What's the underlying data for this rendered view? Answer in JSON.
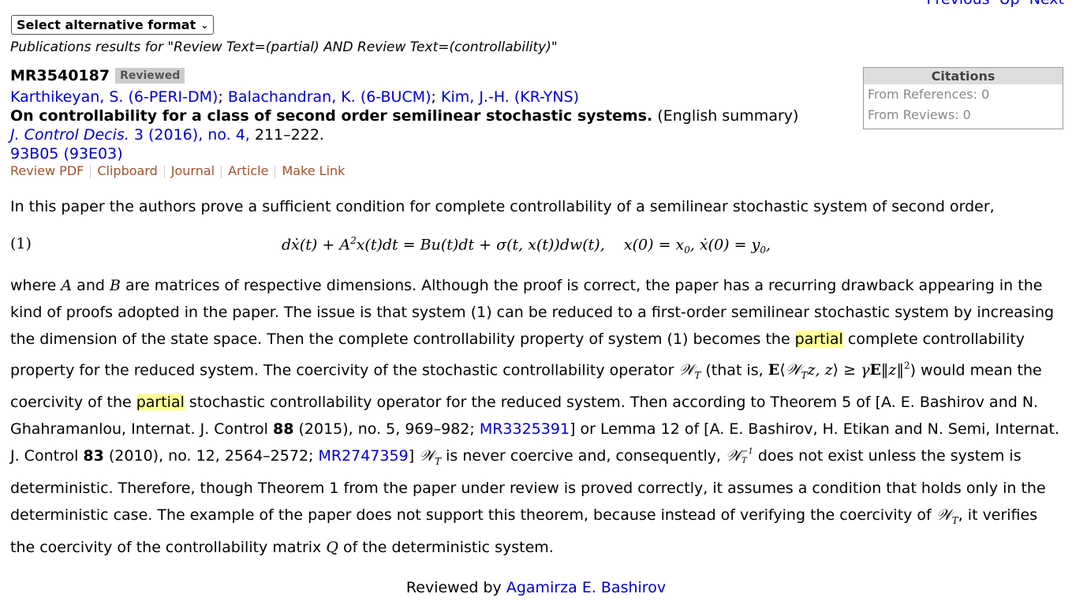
{
  "nav": {
    "prev": "Previous",
    "up": "Up",
    "next": "Next"
  },
  "format_select": "Select alternative format",
  "results_line": "Publications results for \"Review Text=(partial) AND Review Text=(controllability)\"",
  "mr_number": "MR3540187",
  "badge": "Reviewed",
  "authors": [
    "Karthikeyan, S. (6-PERI-DM)",
    "Balachandran, K. (6-BUCM)",
    "Kim, J.-H. (KR-YNS)"
  ],
  "title": "On controllability for a class of second order semilinear stochastic systems.",
  "title_note": "(English summary)",
  "journal": {
    "name": "J. Control Decis.",
    "volume": "3",
    "year": "(2016)",
    "issue": "no. 4,",
    "pages": "211–222."
  },
  "classification": {
    "primary": "93B05",
    "secondary": "(93E03)"
  },
  "actions": [
    "Review PDF",
    "Clipboard",
    "Journal",
    "Article",
    "Make Link"
  ],
  "citations": {
    "header": "Citations",
    "from_references": "From References: 0",
    "from_reviews": "From Reviews: 0"
  },
  "review": {
    "intro": "In this paper the authors prove a sufficient condition for complete controllability of a semilinear stochastic system of second order,",
    "eq_label": "(1)",
    "highlight_word": "partial",
    "ref1_link": "MR3325391",
    "ref2_link": "MR2747359"
  },
  "reviewer": {
    "prefix": "Reviewed by",
    "name": "Agamirza E. Bashirov"
  },
  "colors": {
    "link": "#0000cc",
    "action": "#a0522d",
    "highlight": "#ffff99",
    "badge_bg": "#cccccc"
  }
}
